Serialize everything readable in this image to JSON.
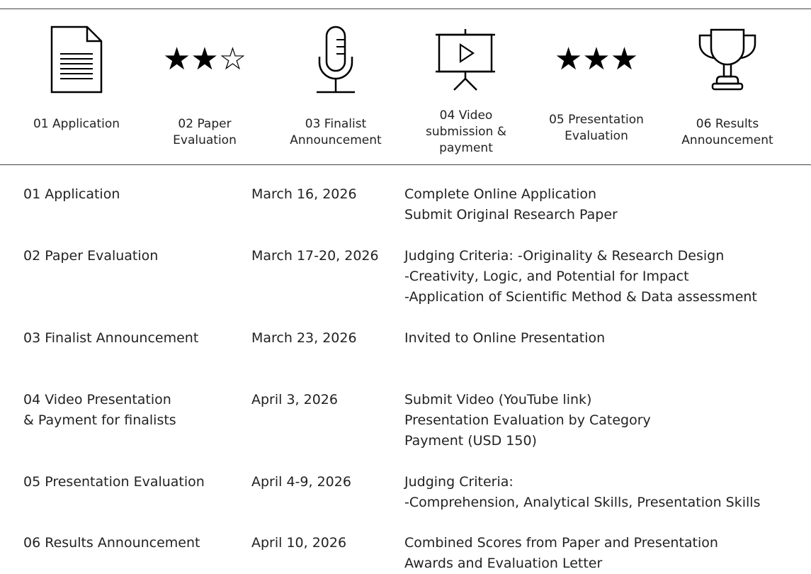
{
  "steps": [
    {
      "icon": "document-icon",
      "label": "01 Application"
    },
    {
      "icon": "two-stars-icon",
      "stars": "★★☆",
      "label": "02 Paper\nEvaluation"
    },
    {
      "icon": "microphone-icon",
      "label": "03 Finalist\nAnnouncement"
    },
    {
      "icon": "presentation-screen-icon",
      "label": "04 Video\nsubmission &\npayment"
    },
    {
      "icon": "three-stars-icon",
      "stars": "★★★",
      "label": "05 Presentation\nEvaluation"
    },
    {
      "icon": "trophy-icon",
      "label": "06 Results\nAnnouncement"
    }
  ],
  "schedule": [
    {
      "stage": "01 Application",
      "date": "March 16, 2026",
      "details": [
        "Complete Online Application",
        "Submit Original Research Paper"
      ]
    },
    {
      "stage": "02 Paper Evaluation",
      "date": "March 17-20, 2026",
      "details": [
        "Judging Criteria: -Originality & Research Design",
        "-Creativity, Logic, and Potential for Impact",
        "-Application of Scientific Method & Data assessment"
      ]
    },
    {
      "stage": "03 Finalist Announcement",
      "date": "March 23, 2026",
      "details": [
        "Invited to Online Presentation"
      ]
    },
    {
      "stage": "04 Video Presentation\n   & Payment for finalists",
      "date": "April 3, 2026",
      "details": [
        "Submit Video (YouTube link)",
        "Presentation Evaluation by Category",
        "Payment (USD 150)"
      ]
    },
    {
      "stage": "05 Presentation Evaluation",
      "date": "April 4-9, 2026",
      "details": [
        "Judging Criteria:",
        "-Comprehension, Analytical Skills, Presentation Skills"
      ]
    },
    {
      "stage": "06 Results Announcement",
      "date": "April 10, 2026",
      "details": [
        "Combined Scores from Paper and Presentation",
        "Awards and Evaluation Letter"
      ]
    }
  ]
}
